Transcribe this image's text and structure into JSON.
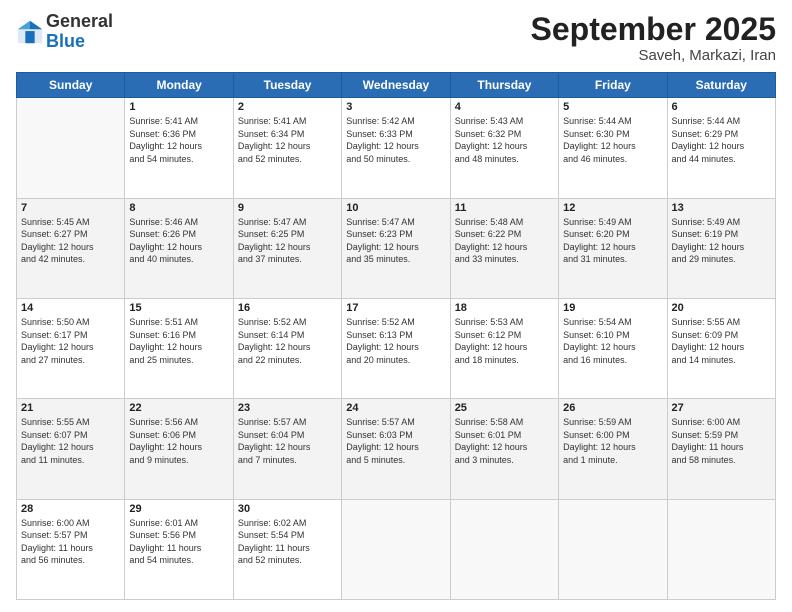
{
  "header": {
    "logo_general": "General",
    "logo_blue": "Blue",
    "month_title": "September 2025",
    "location": "Saveh, Markazi, Iran"
  },
  "weekdays": [
    "Sunday",
    "Monday",
    "Tuesday",
    "Wednesday",
    "Thursday",
    "Friday",
    "Saturday"
  ],
  "weeks": [
    [
      {
        "day": "",
        "info": ""
      },
      {
        "day": "1",
        "info": "Sunrise: 5:41 AM\nSunset: 6:36 PM\nDaylight: 12 hours\nand 54 minutes."
      },
      {
        "day": "2",
        "info": "Sunrise: 5:41 AM\nSunset: 6:34 PM\nDaylight: 12 hours\nand 52 minutes."
      },
      {
        "day": "3",
        "info": "Sunrise: 5:42 AM\nSunset: 6:33 PM\nDaylight: 12 hours\nand 50 minutes."
      },
      {
        "day": "4",
        "info": "Sunrise: 5:43 AM\nSunset: 6:32 PM\nDaylight: 12 hours\nand 48 minutes."
      },
      {
        "day": "5",
        "info": "Sunrise: 5:44 AM\nSunset: 6:30 PM\nDaylight: 12 hours\nand 46 minutes."
      },
      {
        "day": "6",
        "info": "Sunrise: 5:44 AM\nSunset: 6:29 PM\nDaylight: 12 hours\nand 44 minutes."
      }
    ],
    [
      {
        "day": "7",
        "info": "Sunrise: 5:45 AM\nSunset: 6:27 PM\nDaylight: 12 hours\nand 42 minutes."
      },
      {
        "day": "8",
        "info": "Sunrise: 5:46 AM\nSunset: 6:26 PM\nDaylight: 12 hours\nand 40 minutes."
      },
      {
        "day": "9",
        "info": "Sunrise: 5:47 AM\nSunset: 6:25 PM\nDaylight: 12 hours\nand 37 minutes."
      },
      {
        "day": "10",
        "info": "Sunrise: 5:47 AM\nSunset: 6:23 PM\nDaylight: 12 hours\nand 35 minutes."
      },
      {
        "day": "11",
        "info": "Sunrise: 5:48 AM\nSunset: 6:22 PM\nDaylight: 12 hours\nand 33 minutes."
      },
      {
        "day": "12",
        "info": "Sunrise: 5:49 AM\nSunset: 6:20 PM\nDaylight: 12 hours\nand 31 minutes."
      },
      {
        "day": "13",
        "info": "Sunrise: 5:49 AM\nSunset: 6:19 PM\nDaylight: 12 hours\nand 29 minutes."
      }
    ],
    [
      {
        "day": "14",
        "info": "Sunrise: 5:50 AM\nSunset: 6:17 PM\nDaylight: 12 hours\nand 27 minutes."
      },
      {
        "day": "15",
        "info": "Sunrise: 5:51 AM\nSunset: 6:16 PM\nDaylight: 12 hours\nand 25 minutes."
      },
      {
        "day": "16",
        "info": "Sunrise: 5:52 AM\nSunset: 6:14 PM\nDaylight: 12 hours\nand 22 minutes."
      },
      {
        "day": "17",
        "info": "Sunrise: 5:52 AM\nSunset: 6:13 PM\nDaylight: 12 hours\nand 20 minutes."
      },
      {
        "day": "18",
        "info": "Sunrise: 5:53 AM\nSunset: 6:12 PM\nDaylight: 12 hours\nand 18 minutes."
      },
      {
        "day": "19",
        "info": "Sunrise: 5:54 AM\nSunset: 6:10 PM\nDaylight: 12 hours\nand 16 minutes."
      },
      {
        "day": "20",
        "info": "Sunrise: 5:55 AM\nSunset: 6:09 PM\nDaylight: 12 hours\nand 14 minutes."
      }
    ],
    [
      {
        "day": "21",
        "info": "Sunrise: 5:55 AM\nSunset: 6:07 PM\nDaylight: 12 hours\nand 11 minutes."
      },
      {
        "day": "22",
        "info": "Sunrise: 5:56 AM\nSunset: 6:06 PM\nDaylight: 12 hours\nand 9 minutes."
      },
      {
        "day": "23",
        "info": "Sunrise: 5:57 AM\nSunset: 6:04 PM\nDaylight: 12 hours\nand 7 minutes."
      },
      {
        "day": "24",
        "info": "Sunrise: 5:57 AM\nSunset: 6:03 PM\nDaylight: 12 hours\nand 5 minutes."
      },
      {
        "day": "25",
        "info": "Sunrise: 5:58 AM\nSunset: 6:01 PM\nDaylight: 12 hours\nand 3 minutes."
      },
      {
        "day": "26",
        "info": "Sunrise: 5:59 AM\nSunset: 6:00 PM\nDaylight: 12 hours\nand 1 minute."
      },
      {
        "day": "27",
        "info": "Sunrise: 6:00 AM\nSunset: 5:59 PM\nDaylight: 11 hours\nand 58 minutes."
      }
    ],
    [
      {
        "day": "28",
        "info": "Sunrise: 6:00 AM\nSunset: 5:57 PM\nDaylight: 11 hours\nand 56 minutes."
      },
      {
        "day": "29",
        "info": "Sunrise: 6:01 AM\nSunset: 5:56 PM\nDaylight: 11 hours\nand 54 minutes."
      },
      {
        "day": "30",
        "info": "Sunrise: 6:02 AM\nSunset: 5:54 PM\nDaylight: 11 hours\nand 52 minutes."
      },
      {
        "day": "",
        "info": ""
      },
      {
        "day": "",
        "info": ""
      },
      {
        "day": "",
        "info": ""
      },
      {
        "day": "",
        "info": ""
      }
    ]
  ]
}
